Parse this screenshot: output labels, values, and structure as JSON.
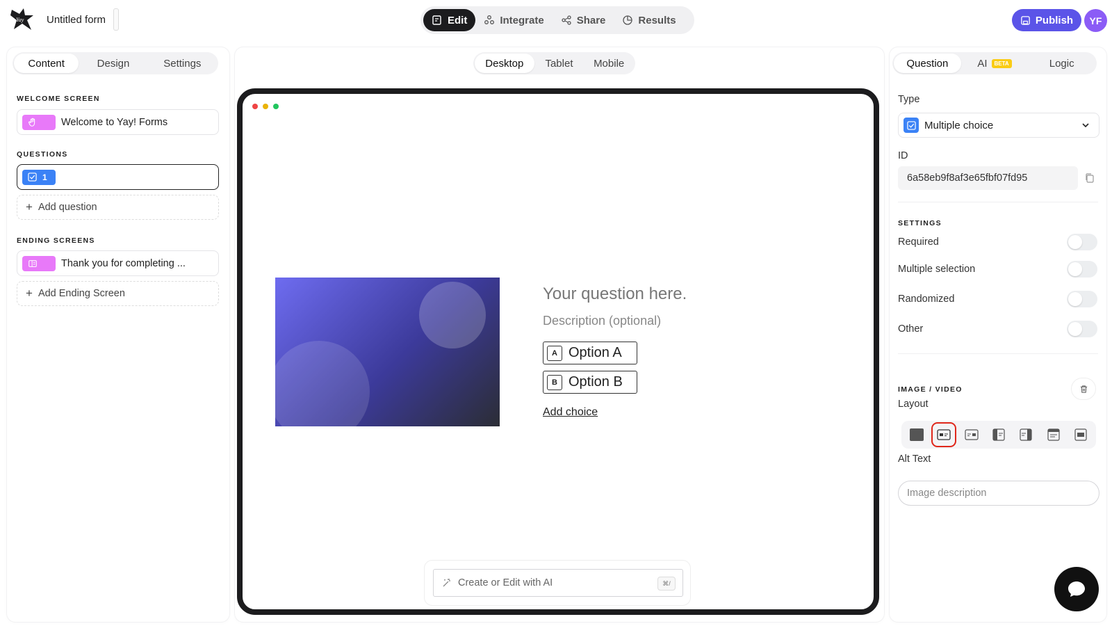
{
  "app": {
    "form_title": "Untitled form",
    "modes": [
      {
        "label": "Edit"
      },
      {
        "label": "Integrate"
      },
      {
        "label": "Share"
      },
      {
        "label": "Results"
      }
    ],
    "publish_label": "Publish",
    "avatar_initials": "YF",
    "accent_color": "#5b54e8"
  },
  "left_panel": {
    "tabs": [
      {
        "label": "Content"
      },
      {
        "label": "Design"
      },
      {
        "label": "Settings"
      }
    ],
    "welcome_section": "WELCOME SCREEN",
    "welcome_item": "Welcome to Yay! Forms",
    "questions_section": "QUESTIONS",
    "question_number": "1",
    "add_question": "Add question",
    "ending_section": "ENDING SCREENS",
    "ending_item": "Thank you for completing ...",
    "add_ending": "Add Ending Screen"
  },
  "center_panel": {
    "device_tabs": [
      {
        "label": "Desktop"
      },
      {
        "label": "Tablet"
      },
      {
        "label": "Mobile"
      }
    ],
    "question_title": "Your question here.",
    "question_description": "Description (optional)",
    "choices": [
      {
        "key": "A",
        "label": "Option A"
      },
      {
        "key": "B",
        "label": "Option B"
      }
    ],
    "add_choice": "Add choice",
    "ai_placeholder": "Create or Edit with AI",
    "ai_shortcut": "⌘/"
  },
  "right_panel": {
    "tabs": [
      {
        "label": "Question"
      },
      {
        "label": "AI"
      },
      {
        "label": "Logic"
      }
    ],
    "ai_badge": "BETA",
    "type_label": "Type",
    "type_value": "Multiple choice",
    "id_label": "ID",
    "id_value": "6a58eb9f8af3e65fbf07fd95",
    "settings_section": "SETTINGS",
    "settings": [
      {
        "label": "Required",
        "on": false
      },
      {
        "label": "Multiple selection",
        "on": false
      },
      {
        "label": "Randomized",
        "on": false
      },
      {
        "label": "Other",
        "on": false
      }
    ],
    "image_section": "IMAGE / VIDEO",
    "layout_label": "Layout",
    "alt_text_label": "Alt Text",
    "alt_text_placeholder": "Image description"
  }
}
